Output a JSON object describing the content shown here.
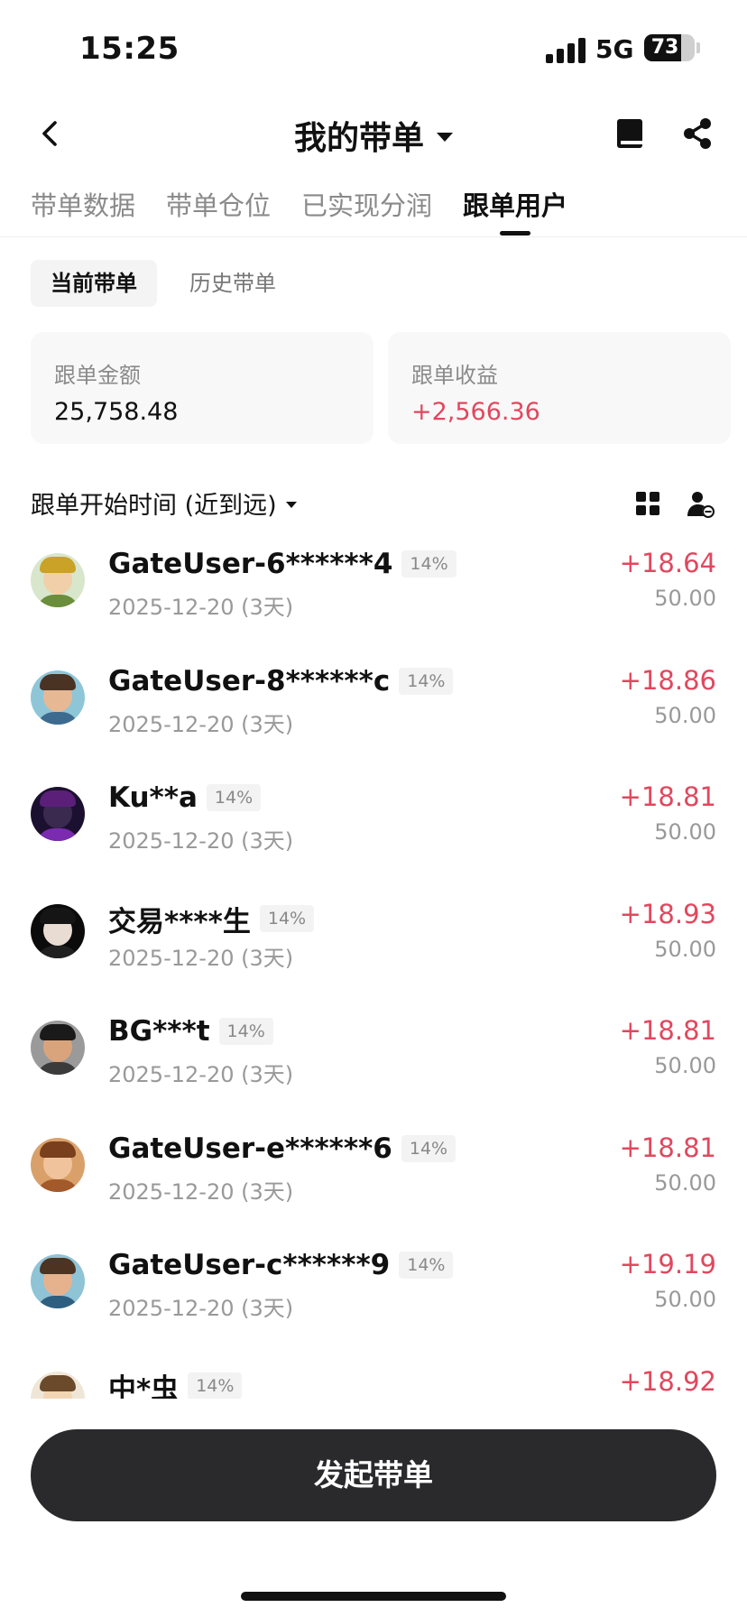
{
  "status_bar": {
    "time": "15:25",
    "network": "5G",
    "battery": "73",
    "battery_level": 0.73
  },
  "header": {
    "title": "我的带单",
    "back_icon": "chevron-left-icon",
    "book_icon": "book-icon",
    "share_icon": "share-icon"
  },
  "tabs": [
    {
      "label": "带单数据",
      "active": false
    },
    {
      "label": "带单仓位",
      "active": false
    },
    {
      "label": "已实现分润",
      "active": false
    },
    {
      "label": "跟单用户",
      "active": true
    }
  ],
  "subtabs": [
    {
      "label": "当前带单",
      "active": true
    },
    {
      "label": "历史带单",
      "active": false
    }
  ],
  "summary": {
    "amount_label": "跟单金额",
    "amount_value": "25,758.48",
    "profit_label": "跟单收益",
    "profit_value": "+2,566.36"
  },
  "sort": {
    "label": "跟单开始时间 (近到远)"
  },
  "followers": [
    {
      "name": "GateUser-6******4",
      "ratio": "14%",
      "date": "2025-12-20 (3天)",
      "profit": "+18.64",
      "amount": "50.00",
      "hair": "#c9a227",
      "face": "#f1cfa8",
      "body": "#6b8e3a",
      "bg": "#d8e6cc"
    },
    {
      "name": "GateUser-8******c",
      "ratio": "14%",
      "date": "2025-12-20 (3天)",
      "profit": "+18.86",
      "amount": "50.00",
      "hair": "#4a3322",
      "face": "#e7b894",
      "body": "#3c6b8f",
      "bg": "#8ec6d8"
    },
    {
      "name": "Ku**a",
      "ratio": "14%",
      "date": "2025-12-20 (3天)",
      "profit": "+18.81",
      "amount": "50.00",
      "hair": "#5b1f7a",
      "face": "#3a2a4f",
      "body": "#7a2bb0",
      "bg": "#1c1030"
    },
    {
      "name": "交易****生",
      "ratio": "14%",
      "date": "2025-12-20 (3天)",
      "profit": "+18.93",
      "amount": "50.00",
      "hair": "#151515",
      "face": "#e9dcd2",
      "body": "#202020",
      "bg": "#0b0b0b"
    },
    {
      "name": "BG***t",
      "ratio": "14%",
      "date": "2025-12-20 (3天)",
      "profit": "+18.81",
      "amount": "50.00",
      "hair": "#1a1a1a",
      "face": "#d9a47c",
      "body": "#3b3b3b",
      "bg": "#9a9a9a"
    },
    {
      "name": "GateUser-e******6",
      "ratio": "14%",
      "date": "2025-12-20 (3天)",
      "profit": "+18.81",
      "amount": "50.00",
      "hair": "#7a3f1c",
      "face": "#f0c39c",
      "body": "#a35a2a",
      "bg": "#d9a06a"
    },
    {
      "name": "GateUser-c******9",
      "ratio": "14%",
      "date": "2025-12-20 (3天)",
      "profit": "+19.19",
      "amount": "50.00",
      "hair": "#4d3321",
      "face": "#e6b28e",
      "body": "#2f5f80",
      "bg": "#8fc3d6"
    },
    {
      "name": "中*虫",
      "ratio": "14%",
      "date": "",
      "profit": "+18.92",
      "amount": "",
      "hair": "#6a4a2a",
      "face": "#f2d6b4",
      "body": "#c9a25e",
      "bg": "#efe6d8"
    }
  ],
  "action": {
    "label": "发起带单"
  },
  "colors": {
    "profit": "#e0485e",
    "button": "#2a2a2c",
    "muted": "#999999"
  }
}
